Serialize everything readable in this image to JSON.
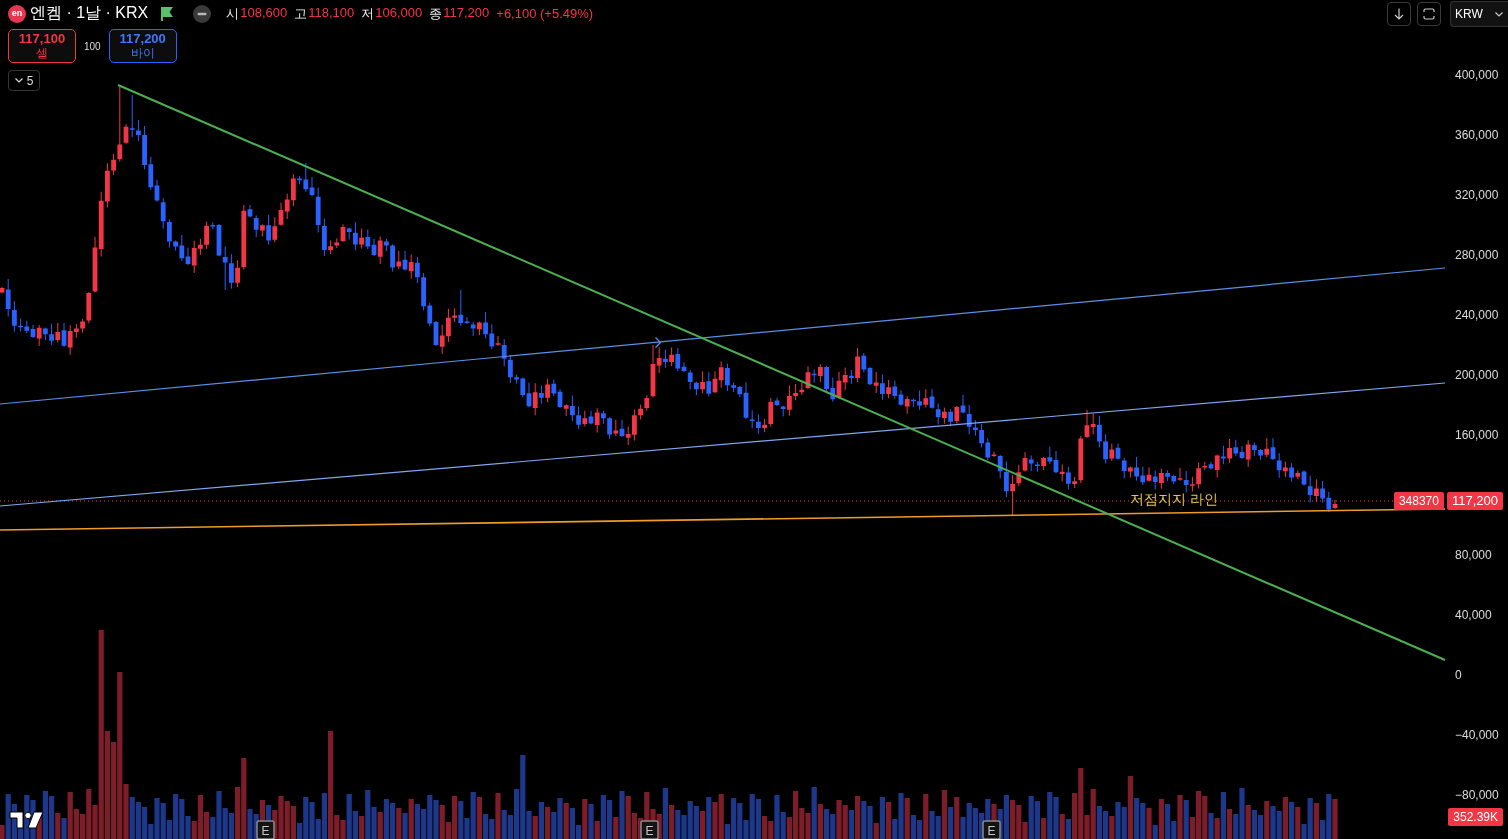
{
  "symbol_bar": {
    "logo_text": "en",
    "title": "엔켐 · 1날 · KRX",
    "ohlc": [
      {
        "label": "시",
        "value": "108,600"
      },
      {
        "label": "고",
        "value": "118,100"
      },
      {
        "label": "저",
        "value": "106,000"
      },
      {
        "label": "종",
        "value": "117,200"
      }
    ],
    "change": "+6,100 (+5.49%)"
  },
  "trade_panel": {
    "buttons": [
      {
        "kind": "sell",
        "price": "117,100",
        "label": "셀"
      },
      {
        "kind": "buy",
        "price": "117,200",
        "label": "바이"
      }
    ],
    "quantity": "100"
  },
  "indicators_toggle": {
    "count": "5"
  },
  "toolbar": {
    "currency": "KRW"
  },
  "price_axis": {
    "upper_labels": [
      "400,000",
      "360,000",
      "320,000",
      "280,000",
      "240,000",
      "200,000",
      "160,000"
    ],
    "lower_labels": [
      "80,000",
      "40,000",
      "0",
      "−40,000",
      "−80,000"
    ]
  },
  "axis_tags": [
    "348370",
    "117,200"
  ],
  "volume_tag": "352.39K",
  "annotation": "저점지지 라인",
  "earnings_markers": [
    "E",
    "E",
    "E"
  ]
}
